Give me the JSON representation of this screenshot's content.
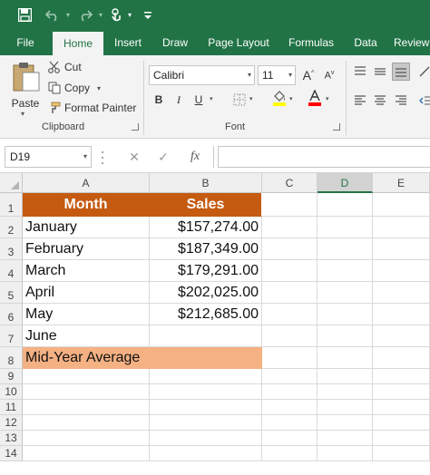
{
  "quick_access": {
    "save_icon": "save-icon",
    "undo_icon": "undo-icon",
    "redo_icon": "redo-icon",
    "touch_icon": "touch-mode-icon",
    "customize_icon": "customize-qat-icon"
  },
  "tabs": [
    {
      "label": "File",
      "active": false
    },
    {
      "label": "Home",
      "active": true
    },
    {
      "label": "Insert",
      "active": false
    },
    {
      "label": "Draw",
      "active": false
    },
    {
      "label": "Page Layout",
      "active": false
    },
    {
      "label": "Formulas",
      "active": false
    },
    {
      "label": "Data",
      "active": false
    },
    {
      "label": "Review",
      "active": false
    }
  ],
  "clipboard": {
    "paste_label": "Paste",
    "cut_label": "Cut",
    "copy_label": "Copy",
    "format_painter_label": "Format Painter",
    "group_label": "Clipboard"
  },
  "font": {
    "font_name": "Calibri",
    "font_size": "11",
    "bold": "B",
    "italic": "I",
    "underline": "U",
    "group_label": "Font",
    "highlight_color": "#ffff00",
    "font_color": "#ff0000"
  },
  "formula_bar": {
    "name_box": "D19",
    "cancel_glyph": "✕",
    "enter_glyph": "✓",
    "fx_label": "fx",
    "formula": ""
  },
  "sheet": {
    "columns": [
      "A",
      "B",
      "C",
      "D",
      "E"
    ],
    "selected_column": "D",
    "row_numbers": [
      "1",
      "2",
      "3",
      "4",
      "5",
      "6",
      "7",
      "8",
      "9",
      "10",
      "11",
      "12",
      "13",
      "14"
    ],
    "header": {
      "month": "Month",
      "sales": "Sales"
    },
    "rows": [
      {
        "month": "January",
        "sales": "$157,274.00"
      },
      {
        "month": "February",
        "sales": "$187,349.00"
      },
      {
        "month": "March",
        "sales": "$179,291.00"
      },
      {
        "month": "April",
        "sales": "$202,025.00"
      },
      {
        "month": "May",
        "sales": "$212,685.00"
      },
      {
        "month": "June",
        "sales": ""
      }
    ],
    "average_label": "Mid-Year Average",
    "header_fill": "#c55a11",
    "average_fill": "#f4b183"
  },
  "colors": {
    "brand": "#217346",
    "ribbon_bg": "#f3f3f3"
  }
}
